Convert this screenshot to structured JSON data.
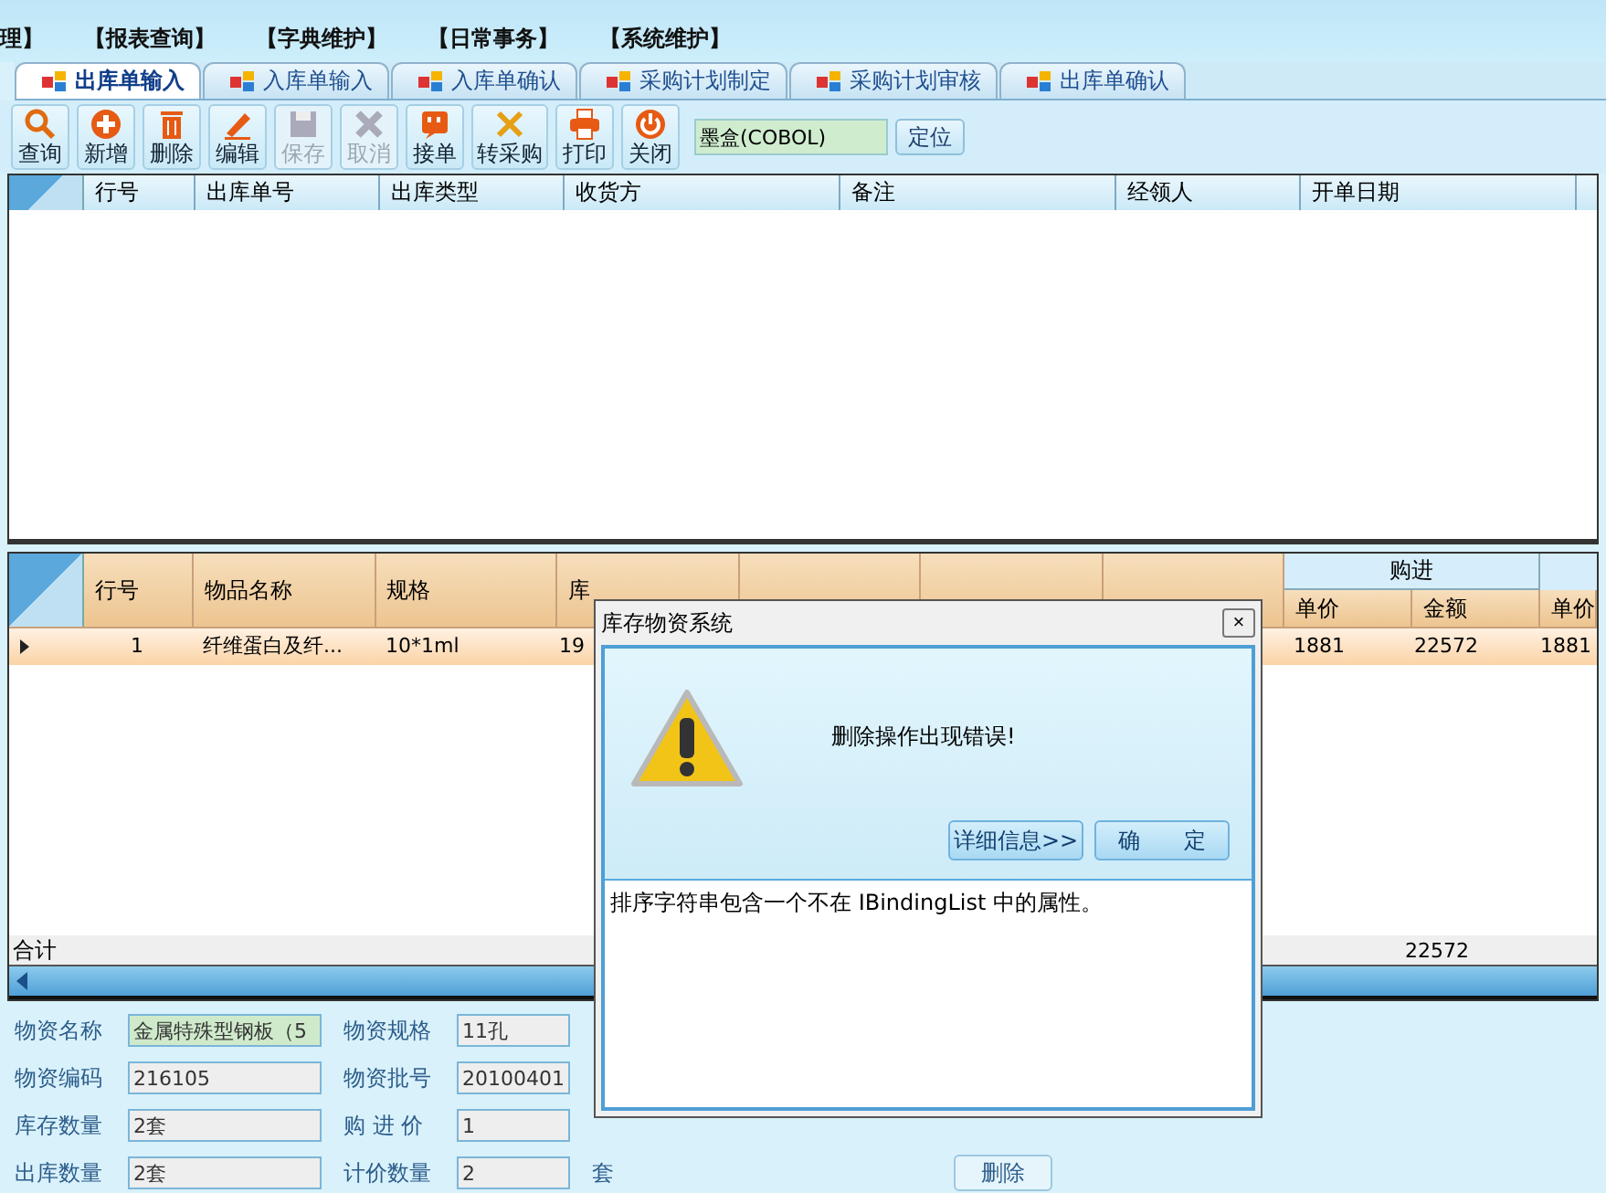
{
  "menu": [
    "理】",
    "【报表查询】",
    "【字典维护】",
    "【日常事务】",
    "【系统维护】"
  ],
  "tabs": [
    {
      "label": "出库单输入",
      "selected": true
    },
    {
      "label": "入库单输入",
      "selected": false
    },
    {
      "label": "入库单确认",
      "selected": false
    },
    {
      "label": "采购计划制定",
      "selected": false
    },
    {
      "label": "采购计划审核",
      "selected": false
    },
    {
      "label": "出库单确认",
      "selected": false
    }
  ],
  "toolbar": [
    {
      "kind": "search",
      "label": "查询",
      "disabled": false
    },
    {
      "kind": "add",
      "label": "新增",
      "disabled": false
    },
    {
      "kind": "delete",
      "label": "删除",
      "disabled": false
    },
    {
      "kind": "edit",
      "label": "编辑",
      "disabled": false
    },
    {
      "kind": "save",
      "label": "保存",
      "disabled": true
    },
    {
      "kind": "cancel",
      "label": "取消",
      "disabled": true
    },
    {
      "kind": "receive",
      "label": "接单",
      "disabled": false
    },
    {
      "kind": "convert",
      "label": "转采购",
      "disabled": false
    },
    {
      "kind": "print",
      "label": "打印",
      "disabled": false
    },
    {
      "kind": "close",
      "label": "关闭",
      "disabled": false
    }
  ],
  "locate": {
    "value": "墨盒(COBOL)",
    "button": "定位"
  },
  "upper_table": {
    "columns": [
      "行号",
      "出库单号",
      "出库类型",
      "收货方",
      "备注",
      "经领人",
      "开单日期"
    ]
  },
  "lower_table": {
    "columns": [
      "行号",
      "物品名称",
      "规格",
      "库"
    ],
    "group": {
      "label": "购进",
      "columns": [
        "单价",
        "金额"
      ]
    },
    "extra_column": "单价",
    "rows": [
      {
        "selected": true,
        "cells": [
          "1",
          "纤维蛋白及纤...",
          "10*1ml",
          "19"
        ],
        "group_cells": [
          "1881",
          "22572"
        ],
        "extra_cell": "1881"
      }
    ],
    "total_label": "合计",
    "total_amount": "22572"
  },
  "form": [
    {
      "label": "物资名称",
      "value": "金属特殊型钢板（5",
      "highlighted": true,
      "label2": "物资规格",
      "value2": "11孔"
    },
    {
      "label": "物资编码",
      "value": "216105",
      "highlighted": false,
      "label2": "物资批号",
      "value2": "20100401"
    },
    {
      "label": "库存数量",
      "value": "2套",
      "highlighted": false,
      "label2": "购 进 价",
      "value2": "1"
    },
    {
      "label": "出库数量",
      "value": "2套",
      "highlighted": false,
      "label2": "计价数量",
      "value2": "2",
      "unit": "套",
      "button": "删除"
    }
  ],
  "dialog": {
    "title": "库存物资系统",
    "close": "×",
    "message": "删除操作出现错误!",
    "buttons": [
      "详细信息>>",
      "确　　定"
    ],
    "details": "排序字符串包含一个不在 IBindingList 中的属性。"
  }
}
